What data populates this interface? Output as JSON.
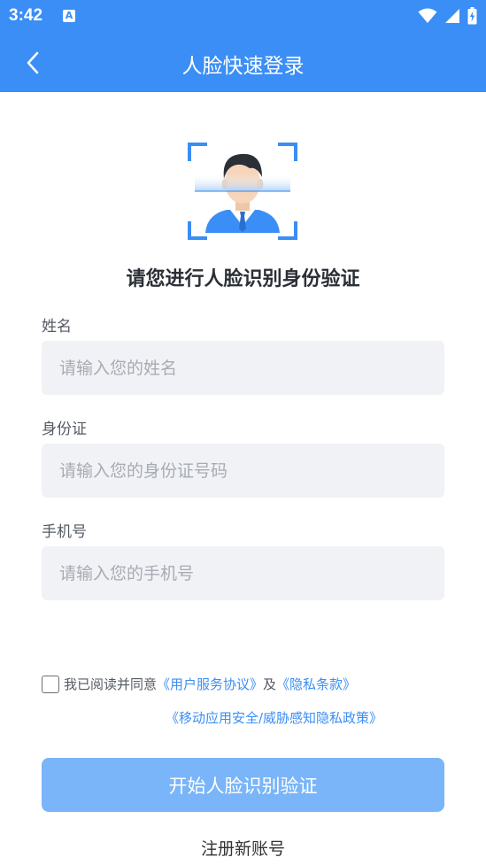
{
  "status_bar": {
    "time": "3:42",
    "notification_icon": "A",
    "icons": [
      "wifi-icon",
      "signal-icon",
      "battery-charging-icon"
    ]
  },
  "header": {
    "title": "人脸快速登录",
    "back_icon": "chevron-left-icon"
  },
  "main": {
    "illustration": "face-scan-icon",
    "heading": "请您进行人脸识别身份验证",
    "fields": [
      {
        "label": "姓名",
        "placeholder": "请输入您的姓名",
        "value": ""
      },
      {
        "label": "身份证",
        "placeholder": "请输入您的身份证号码",
        "value": ""
      },
      {
        "label": "手机号",
        "placeholder": "请输入您的手机号",
        "value": ""
      }
    ],
    "agreement": {
      "checked": false,
      "prefix": "我已阅读并同意",
      "link_service": "《用户服务协议》",
      "and": "及",
      "link_privacy": "《隐私条款》",
      "link_mobile_policy": "《移动应用安全/威胁感知隐私政策》"
    },
    "start_button_label": "开始人脸识别验证",
    "register_label": "注册新账号"
  },
  "colors": {
    "primary": "#3a8ef5",
    "button_disabled": "#79b5f8",
    "input_bg": "#f1f2f6"
  }
}
